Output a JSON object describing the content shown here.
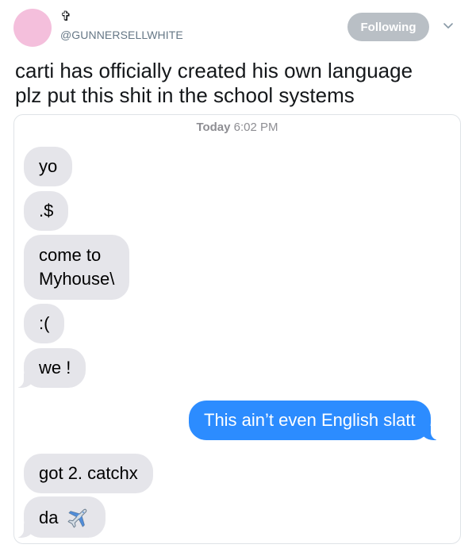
{
  "tweet": {
    "display_name": "✞",
    "handle": "@GUNNERSELLWHITE",
    "follow_label": "Following",
    "text_lines": [
      "carti has officially created his own language",
      "plz put this shit in the school systems"
    ]
  },
  "conversation": {
    "timestamp_day": "Today",
    "timestamp_time": "6:02 PM",
    "messages": [
      {
        "text": "yo",
        "from": "them"
      },
      {
        "text": ".$",
        "from": "them"
      },
      {
        "text_lines": [
          "come to",
          "Myhouse\\"
        ],
        "from": "them"
      },
      {
        "text": ":(",
        "from": "them"
      },
      {
        "text": "we !",
        "from": "them"
      },
      {
        "text": "This ain’t even English slatt",
        "from": "me"
      },
      {
        "text": "got 2. catchx",
        "from": "them"
      },
      {
        "text": "da",
        "from": "them",
        "icon": "airplane-icon"
      }
    ]
  },
  "colors": {
    "avatar": "#f4bfdc",
    "follow_button": "#b9bfc5",
    "received_bubble": "#e5e5ea",
    "sent_bubble": "#2c8cff"
  }
}
